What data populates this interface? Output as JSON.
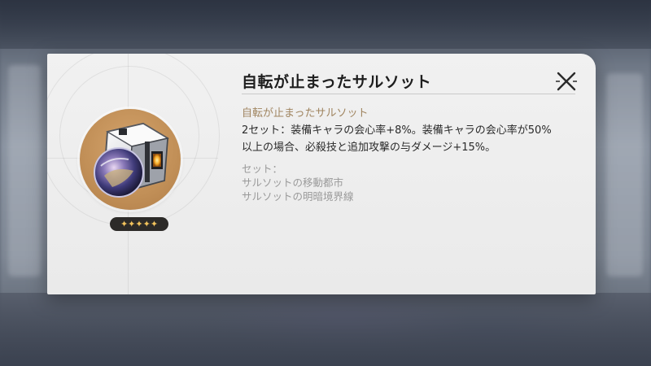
{
  "popup": {
    "title": "自転が止まったサルソット",
    "set_name": "自転が止まったサルソット",
    "effect_line1": "2セット：装備キャラの会心率+8%。装備キャラの会心率が50%",
    "effect_line2": "以上の場合、必殺技と追加攻撃の与ダメージ+15%。",
    "set_label": "セット：",
    "set_items": [
      "サルソットの移動都市",
      "サルソットの明暗境界線"
    ],
    "rarity_stars": 5,
    "star_glyphs": "✦✦✦✦✦",
    "close_icon": "close-x-icon",
    "relic_icon": "planar-ornament-sphere-icon"
  },
  "colors": {
    "set_name": "#a08560",
    "medallion": "#c18f57",
    "stars": "#f2c35c",
    "panel": "#efefef"
  }
}
